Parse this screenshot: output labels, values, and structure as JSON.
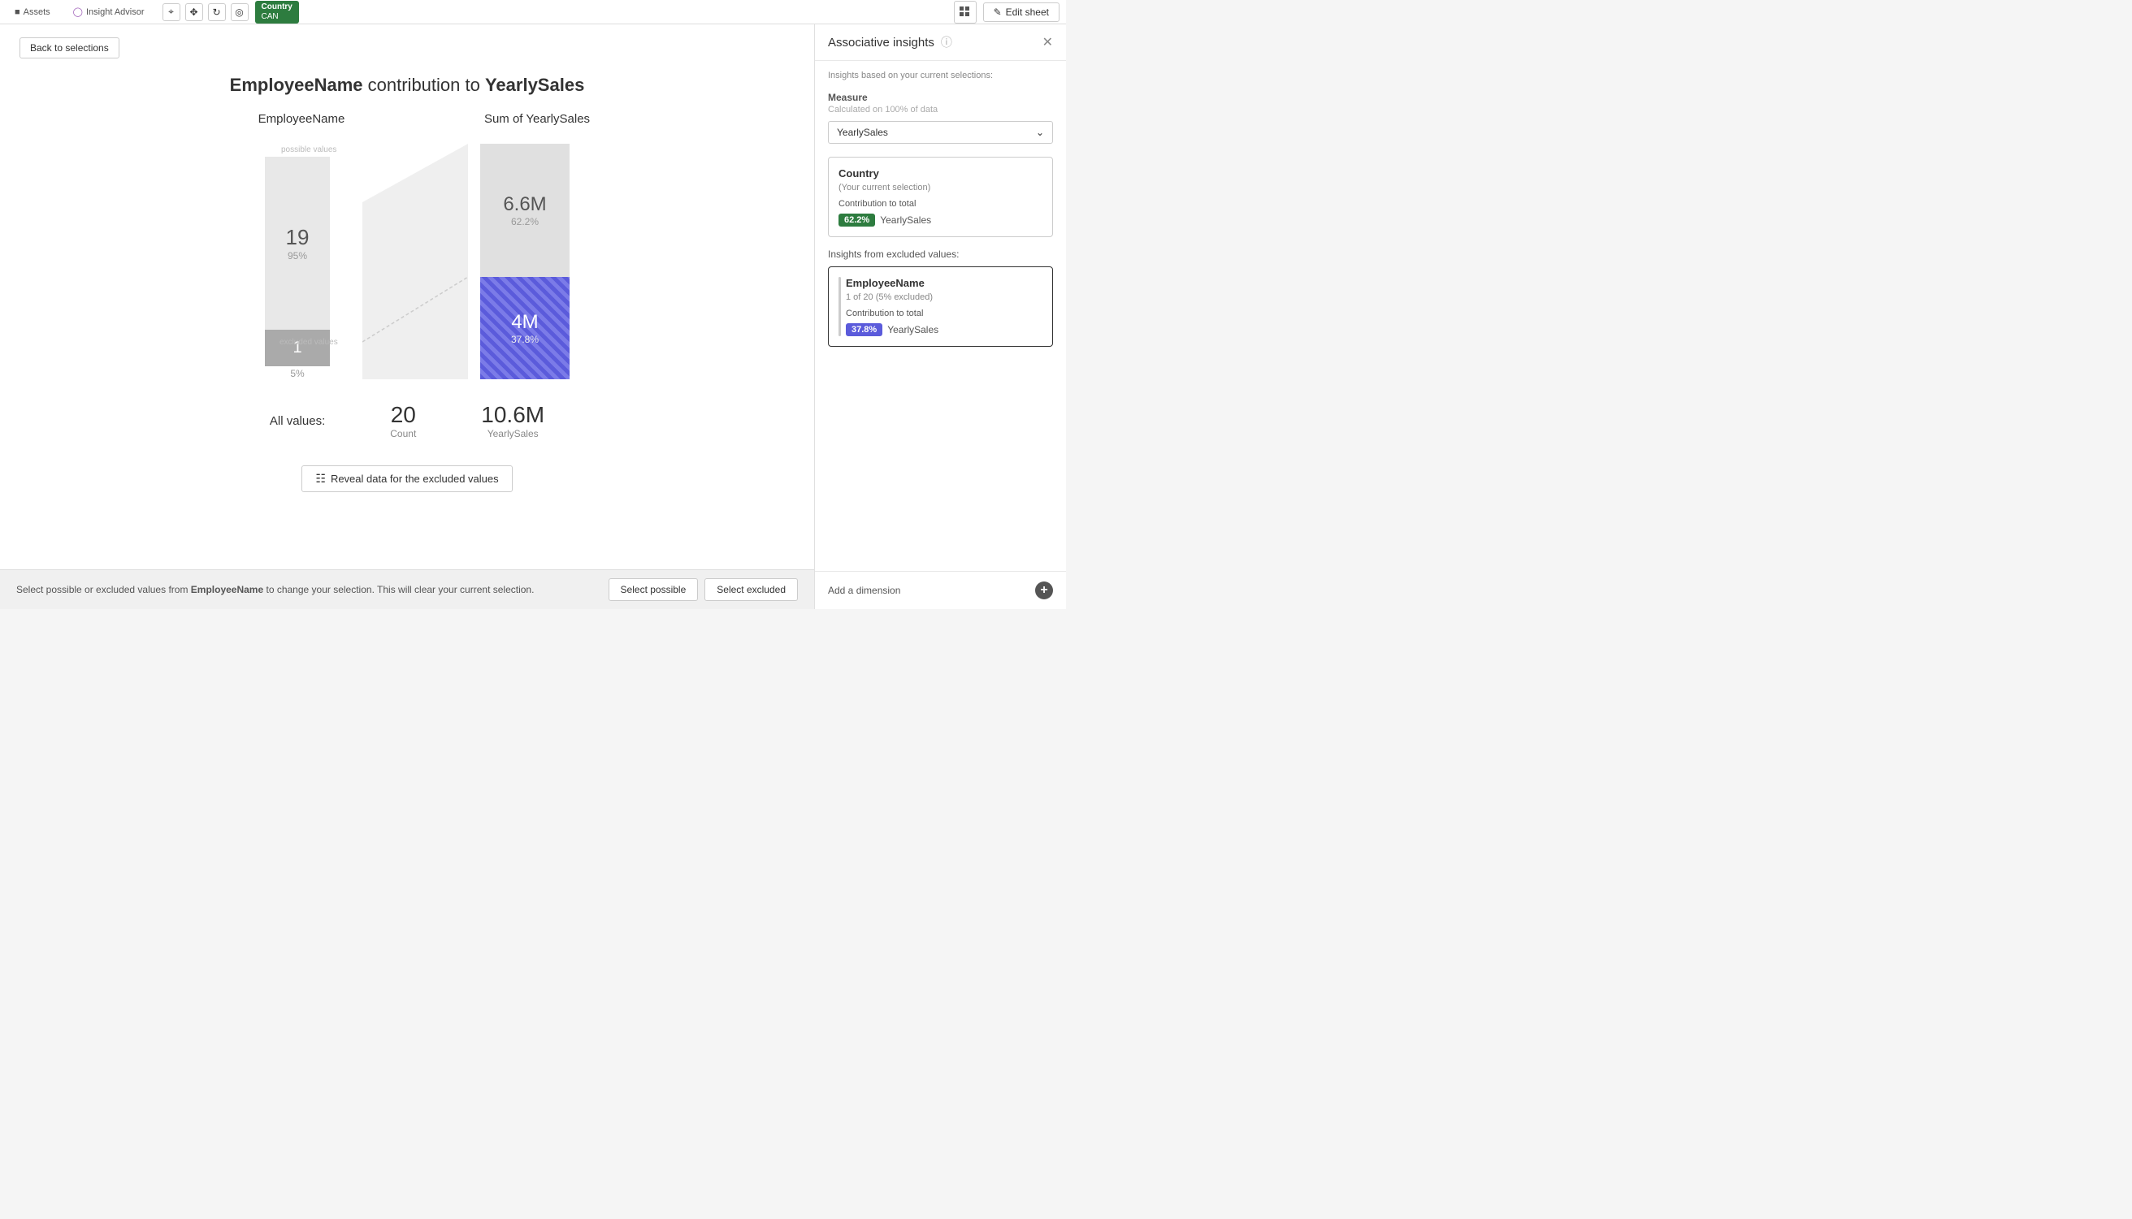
{
  "topbar": {
    "assets_label": "Assets",
    "insight_label": "Insight Advisor",
    "edit_sheet_label": "Edit sheet",
    "selection_field": "Country",
    "selection_value": "CAN"
  },
  "back_btn": "Back to selections",
  "chart": {
    "title_dimension": "EmployeeName",
    "title_connector": " contribution to ",
    "title_measure": "YearlySales",
    "col1_header": "EmployeeName",
    "col2_header": "Sum of YearlySales",
    "possible_label": "possible values",
    "excluded_label": "excluded values",
    "possible_count": "19",
    "possible_pct": "95%",
    "excluded_count": "1",
    "excluded_pct": "5%",
    "sales_possible_val": "6.6M",
    "sales_possible_pct": "62.2%",
    "sales_excluded_val": "4M",
    "sales_excluded_pct": "37.8%",
    "all_values_label": "All values:",
    "all_count": "20",
    "all_count_sub": "Count",
    "all_sales": "10.6M",
    "all_sales_sub": "YearlySales",
    "reveal_btn_label": "Reveal data for the excluded values"
  },
  "bottom_bar": {
    "text_prefix": "Select possible or excluded values from ",
    "field": "EmployeeName",
    "text_suffix": " to change your selection. This will clear your current selection.",
    "btn_possible": "Select possible",
    "btn_excluded": "Select excluded"
  },
  "right_panel": {
    "title": "Associative insights",
    "subtitle": "Insights based on your current selections:",
    "measure_section_label": "Measure",
    "measure_section_sub": "Calculated on 100% of data",
    "measure_value": "YearlySales",
    "country_card": {
      "title": "Country",
      "subtitle": "(Your current selection)",
      "contribution_label": "Contribution to total",
      "badge": "62.2%",
      "measure": "YearlySales"
    },
    "excluded_section_label": "Insights from excluded values:",
    "employee_card": {
      "title": "EmployeeName",
      "subtitle": "1 of 20 (5% excluded)",
      "contribution_label": "Contribution to total",
      "badge": "37.8%",
      "measure": "YearlySales"
    },
    "add_dimension_label": "Add a dimension"
  }
}
